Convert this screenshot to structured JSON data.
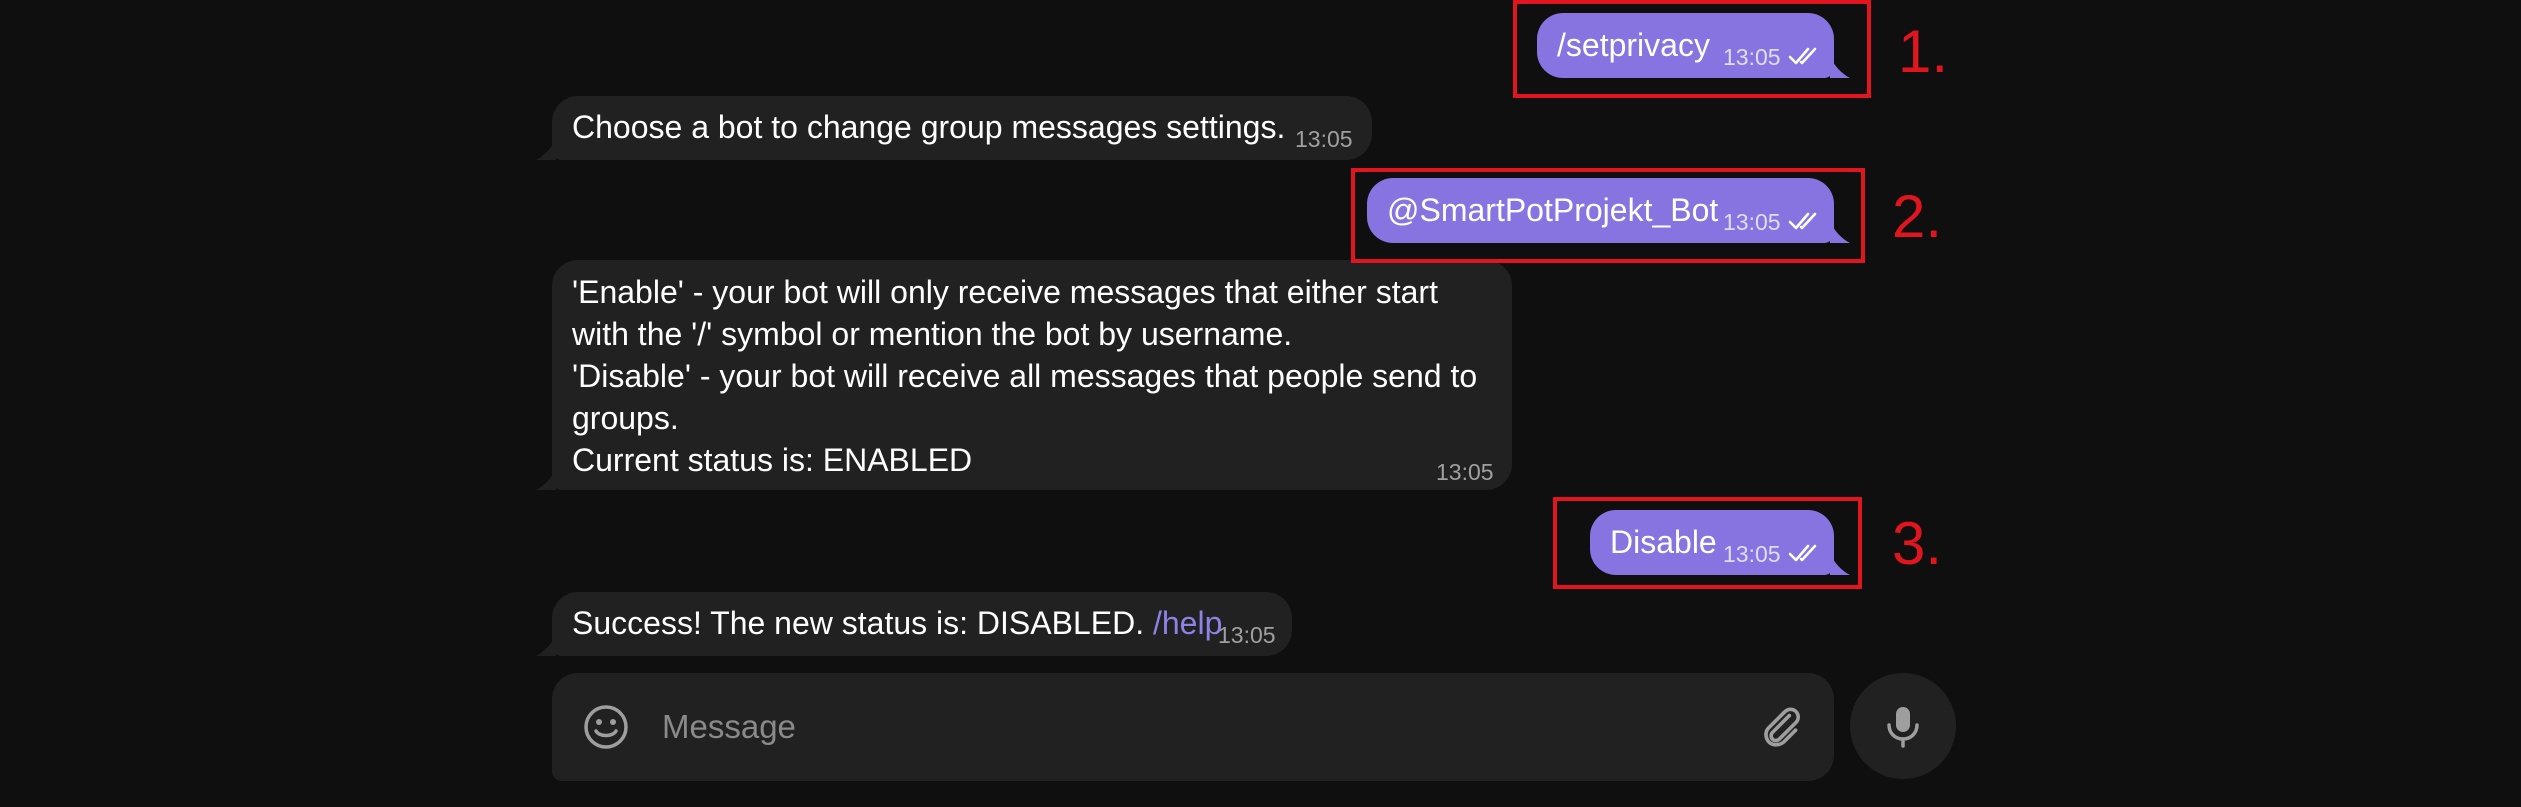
{
  "messages": [
    {
      "direction": "out",
      "text": "/setprivacy",
      "time": "13:05"
    },
    {
      "direction": "in",
      "text": "Choose a bot to change group messages settings.",
      "time": "13:05"
    },
    {
      "direction": "out",
      "text": "@SmartPotProjekt_Bot",
      "time": "13:05"
    },
    {
      "direction": "in",
      "lines": [
        "'Enable' - your bot will only receive messages that either start",
        "with the '/' symbol or mention the bot by username.",
        "'Disable' - your bot will receive all messages that people send to",
        "groups.",
        "Current status is: ENABLED"
      ],
      "time": "13:05"
    },
    {
      "direction": "out",
      "text": "Disable",
      "time": "13:05"
    },
    {
      "direction": "in",
      "text": "Success! The new status is: DISABLED.",
      "command": "/help",
      "time": "13:05"
    }
  ],
  "annotations": [
    "1.",
    "2.",
    "3."
  ],
  "composer": {
    "placeholder": "Message"
  },
  "icons": {
    "emoji": "smile-icon",
    "attach": "paperclip-icon",
    "mic": "microphone-icon",
    "read_receipt": "double-check-icon"
  },
  "colors": {
    "background": "#0f0f0f",
    "outgoing_bubble": "#8774e1",
    "incoming_bubble": "#212121",
    "annotation": "#e0151e",
    "command_link": "#8d82e6"
  }
}
